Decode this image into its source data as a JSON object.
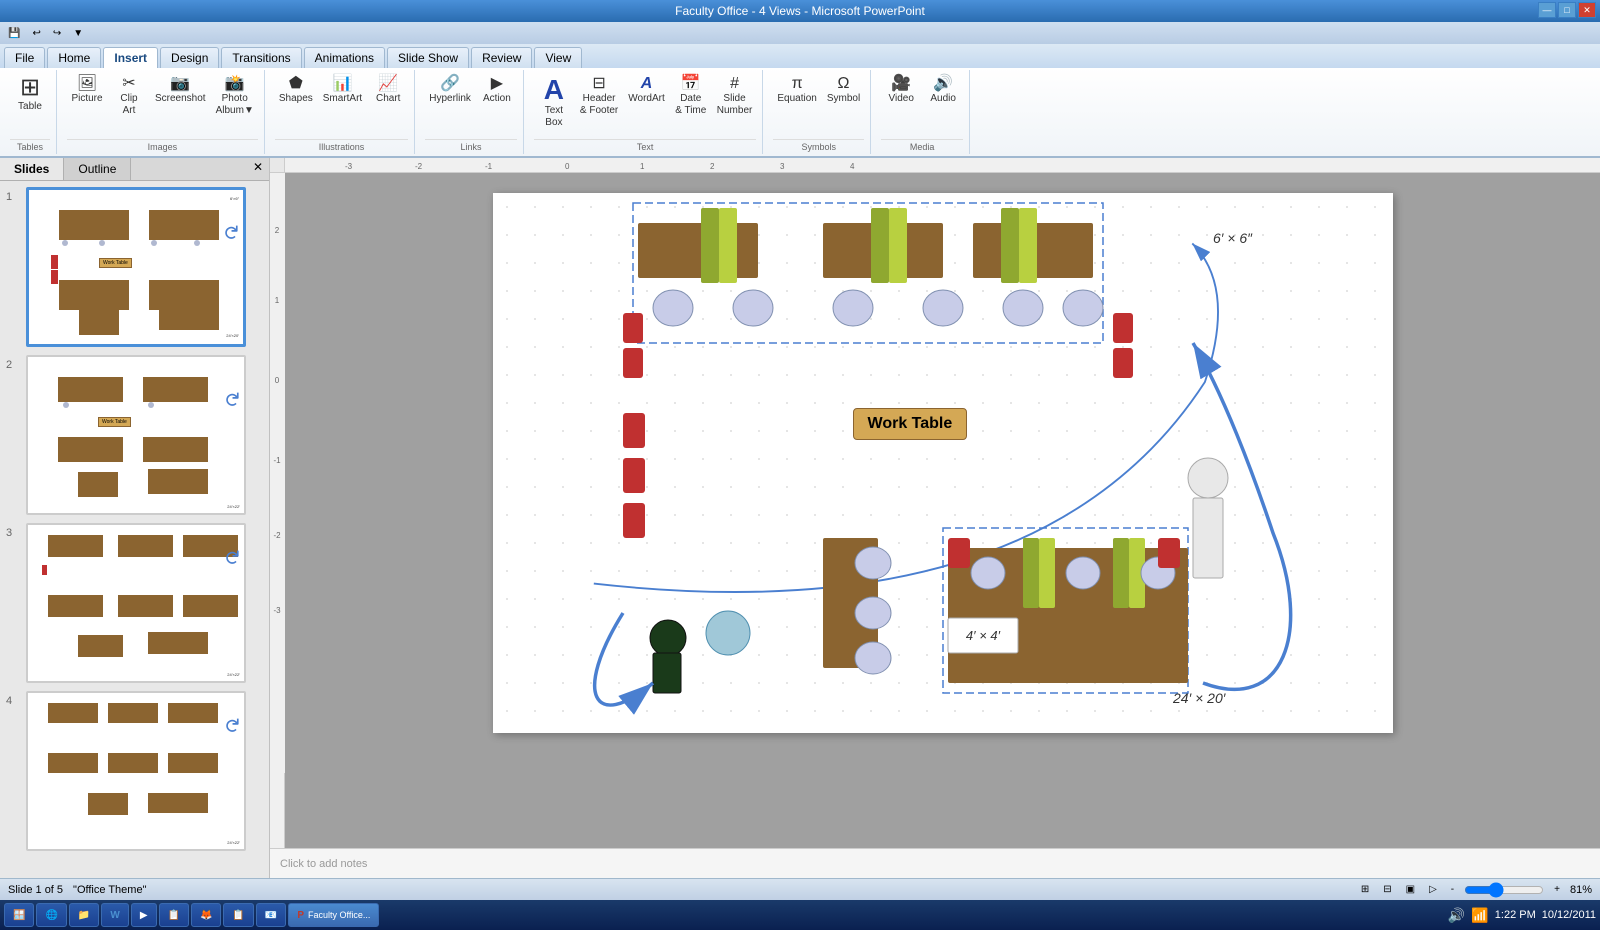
{
  "titleBar": {
    "title": "Faculty Office - 4 Views - Microsoft PowerPoint",
    "minBtn": "—",
    "maxBtn": "□",
    "closeBtn": "✕"
  },
  "quickAccess": {
    "buttons": [
      "💾",
      "↩",
      "▶"
    ]
  },
  "ribbonTabs": {
    "tabs": [
      "File",
      "Home",
      "Insert",
      "Design",
      "Transitions",
      "Animations",
      "Slide Show",
      "Review",
      "View"
    ],
    "activeTab": "Insert"
  },
  "ribbon": {
    "groups": [
      {
        "label": "Tables",
        "items": [
          {
            "icon": "⊞",
            "label": "Table"
          }
        ]
      },
      {
        "label": "Images",
        "items": [
          {
            "icon": "🖼",
            "label": "Picture"
          },
          {
            "icon": "✂",
            "label": "Clip Art"
          },
          {
            "icon": "📷",
            "label": "Screenshot"
          },
          {
            "icon": "🖼",
            "label": "Photo Album"
          }
        ]
      },
      {
        "label": "Illustrations",
        "items": [
          {
            "icon": "⬟",
            "label": "Shapes"
          },
          {
            "icon": "📊",
            "label": "SmartArt"
          },
          {
            "icon": "📈",
            "label": "Chart"
          }
        ]
      },
      {
        "label": "Links",
        "items": [
          {
            "icon": "🔗",
            "label": "Hyperlink"
          },
          {
            "icon": "▶",
            "label": "Action"
          }
        ]
      },
      {
        "label": "Text",
        "items": [
          {
            "icon": "A",
            "label": "Text Box"
          },
          {
            "icon": "⊟",
            "label": "Header & Footer"
          },
          {
            "icon": "A",
            "label": "WordArt"
          },
          {
            "icon": "📅",
            "label": "Date & Time"
          },
          {
            "icon": "#",
            "label": "Slide Number"
          }
        ]
      },
      {
        "label": "Symbols",
        "items": [
          {
            "icon": "∑",
            "label": "Equation"
          },
          {
            "icon": "Ω",
            "label": "Symbol"
          }
        ]
      },
      {
        "label": "Media",
        "items": [
          {
            "icon": "▶",
            "label": "Video"
          },
          {
            "icon": "🎵",
            "label": "Audio"
          }
        ]
      }
    ]
  },
  "slideTabs": [
    "Slides",
    "Outline"
  ],
  "slides": [
    {
      "num": "1",
      "active": true
    },
    {
      "num": "2",
      "active": false
    },
    {
      "num": "3",
      "active": false
    },
    {
      "num": "4",
      "active": false
    }
  ],
  "slide": {
    "workTableLabel": "Work Table",
    "dim1": "6′ × 6″",
    "dim2": "4′ × 4′",
    "dim3": "24′ × 20′"
  },
  "notes": {
    "placeholder": "Click to add notes"
  },
  "statusBar": {
    "slideInfo": "Slide 1 of 5",
    "theme": "\"Office Theme\"",
    "zoomLevel": "81%",
    "viewButtons": [
      "⊞",
      "⊟",
      "▣",
      "📽"
    ]
  },
  "taskbar": {
    "startBtn": "🪟",
    "apps": [
      {
        "icon": "🌐",
        "label": "IE"
      },
      {
        "icon": "📁",
        "label": "Explorer"
      },
      {
        "icon": "W",
        "label": "Word"
      },
      {
        "icon": "▶",
        "label": "WMP"
      },
      {
        "icon": "📋",
        "label": "App"
      },
      {
        "icon": "🦊",
        "label": "Firefox"
      },
      {
        "icon": "📋",
        "label": "App2"
      },
      {
        "icon": "📧",
        "label": "Outlook"
      },
      {
        "icon": "P",
        "label": "PowerPoint",
        "active": true
      }
    ],
    "time": "1:22 PM",
    "date": "10/12/2011"
  }
}
